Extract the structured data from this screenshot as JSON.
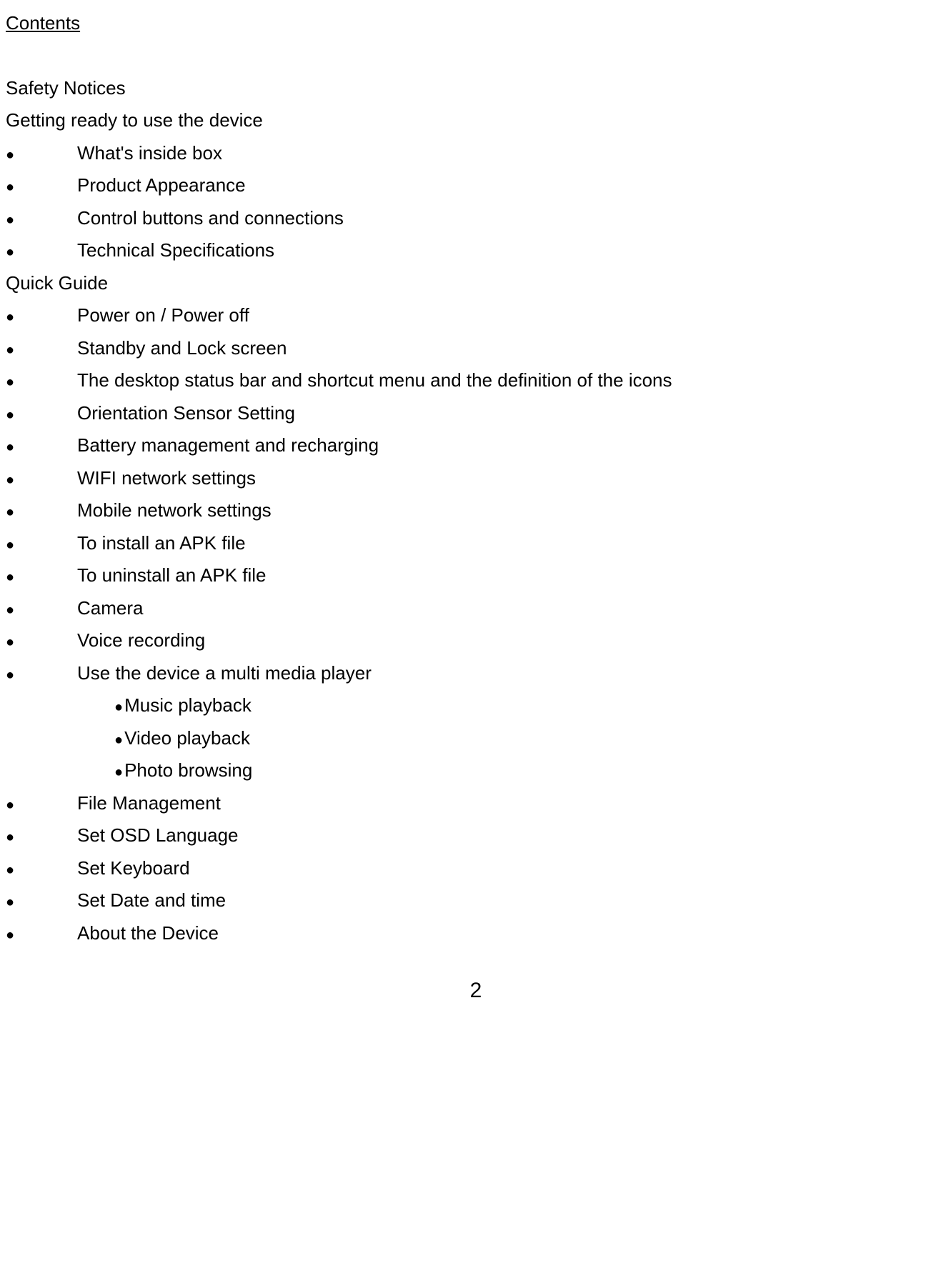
{
  "title": "Contents",
  "sections": [
    {
      "label": "Safety Notices"
    },
    {
      "label": "Getting ready to use the device"
    }
  ],
  "bullets1": [
    "What's inside box",
    "Product Appearance",
    "Control buttons and connections",
    "Technical Specifications"
  ],
  "section3": "Quick Guide",
  "bullets2": [
    "Power on / Power off",
    "Standby and Lock screen",
    "The desktop status bar and shortcut menu and the definition of the icons",
    "Orientation Sensor Setting",
    "Battery management and recharging",
    "WIFI network settings",
    "Mobile network settings",
    "To install an APK file",
    "To uninstall an APK file",
    "Camera",
    "Voice recording",
    "Use the device a multi media player"
  ],
  "subBullets": [
    "Music playback",
    "Video playback",
    "Photo browsing"
  ],
  "bullets3": [
    "File Management",
    "Set OSD Language",
    "Set Keyboard",
    "Set Date and time",
    "About the Device"
  ],
  "pageNumber": "2"
}
